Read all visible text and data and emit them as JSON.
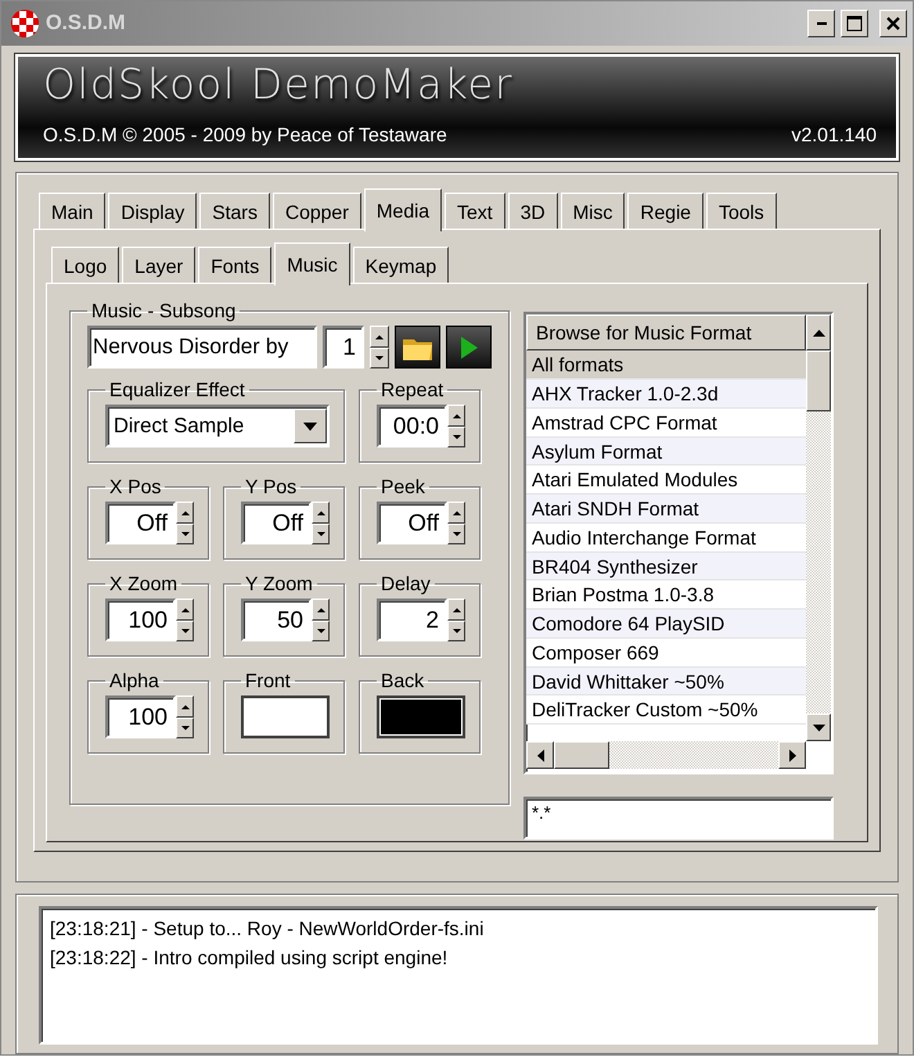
{
  "window": {
    "title": "O.S.D.M"
  },
  "banner": {
    "logo": "OldSkool DemoMaker",
    "credit": "O.S.D.M  © 2005 - 2009 by Peace of Testaware",
    "version": "v2.01.140"
  },
  "tabs": [
    {
      "label": "Main",
      "selected": false
    },
    {
      "label": "Display",
      "selected": false
    },
    {
      "label": "Stars",
      "selected": false
    },
    {
      "label": "Copper",
      "selected": false
    },
    {
      "label": "Media",
      "selected": true
    },
    {
      "label": "Text",
      "selected": false
    },
    {
      "label": "3D",
      "selected": false
    },
    {
      "label": "Misc",
      "selected": false
    },
    {
      "label": "Regie",
      "selected": false
    },
    {
      "label": "Tools",
      "selected": false
    }
  ],
  "subtabs": [
    {
      "label": "Logo",
      "selected": false
    },
    {
      "label": "Layer",
      "selected": false
    },
    {
      "label": "Fonts",
      "selected": false
    },
    {
      "label": "Music",
      "selected": true
    },
    {
      "label": "Keymap",
      "selected": false
    }
  ],
  "music": {
    "legend": "Music - Subsong",
    "song": "Nervous Disorder by",
    "subsong": "1"
  },
  "equalizer": {
    "legend": "Equalizer Effect",
    "value": "Direct Sample"
  },
  "repeat": {
    "legend": "Repeat",
    "value": "00:0"
  },
  "settings": [
    {
      "kind": "spin",
      "label": "X Pos",
      "value": "Off"
    },
    {
      "kind": "spin",
      "label": "Y Pos",
      "value": "Off"
    },
    {
      "kind": "spin",
      "label": "Peek",
      "value": "Off"
    },
    {
      "kind": "spin",
      "label": "X Zoom",
      "value": "100"
    },
    {
      "kind": "spin",
      "label": "Y Zoom",
      "value": "50"
    },
    {
      "kind": "spin",
      "label": "Delay",
      "value": "2"
    },
    {
      "kind": "spin",
      "label": "Alpha",
      "value": "100"
    },
    {
      "kind": "color",
      "label": "Front",
      "color": "#ffffff"
    },
    {
      "kind": "color",
      "label": "Back",
      "color": "#000000"
    }
  ],
  "browser": {
    "header": "Browse for Music Format",
    "items": [
      {
        "label": "All formats",
        "selected": true
      },
      {
        "label": "AHX Tracker 1.0-2.3d",
        "selected": false
      },
      {
        "label": "Amstrad CPC Format",
        "selected": false
      },
      {
        "label": "Asylum Format",
        "selected": false
      },
      {
        "label": "Atari Emulated Modules",
        "selected": false
      },
      {
        "label": "Atari SNDH Format",
        "selected": false
      },
      {
        "label": "Audio Interchange Format",
        "selected": false
      },
      {
        "label": "BR404 Synthesizer",
        "selected": false
      },
      {
        "label": "Brian Postma 1.0-3.8",
        "selected": false
      },
      {
        "label": "Comodore 64 PlaySID",
        "selected": false
      },
      {
        "label": "Composer 669",
        "selected": false
      },
      {
        "label": "David Whittaker ~50%",
        "selected": false
      },
      {
        "label": "DeliTracker Custom ~50%",
        "selected": false
      }
    ],
    "filter": "*.*"
  },
  "log": [
    "[23:18:21] - Setup to... Roy - NewWorldOrder-fs.ini",
    "[23:18:22] - Intro compiled using script engine!"
  ]
}
